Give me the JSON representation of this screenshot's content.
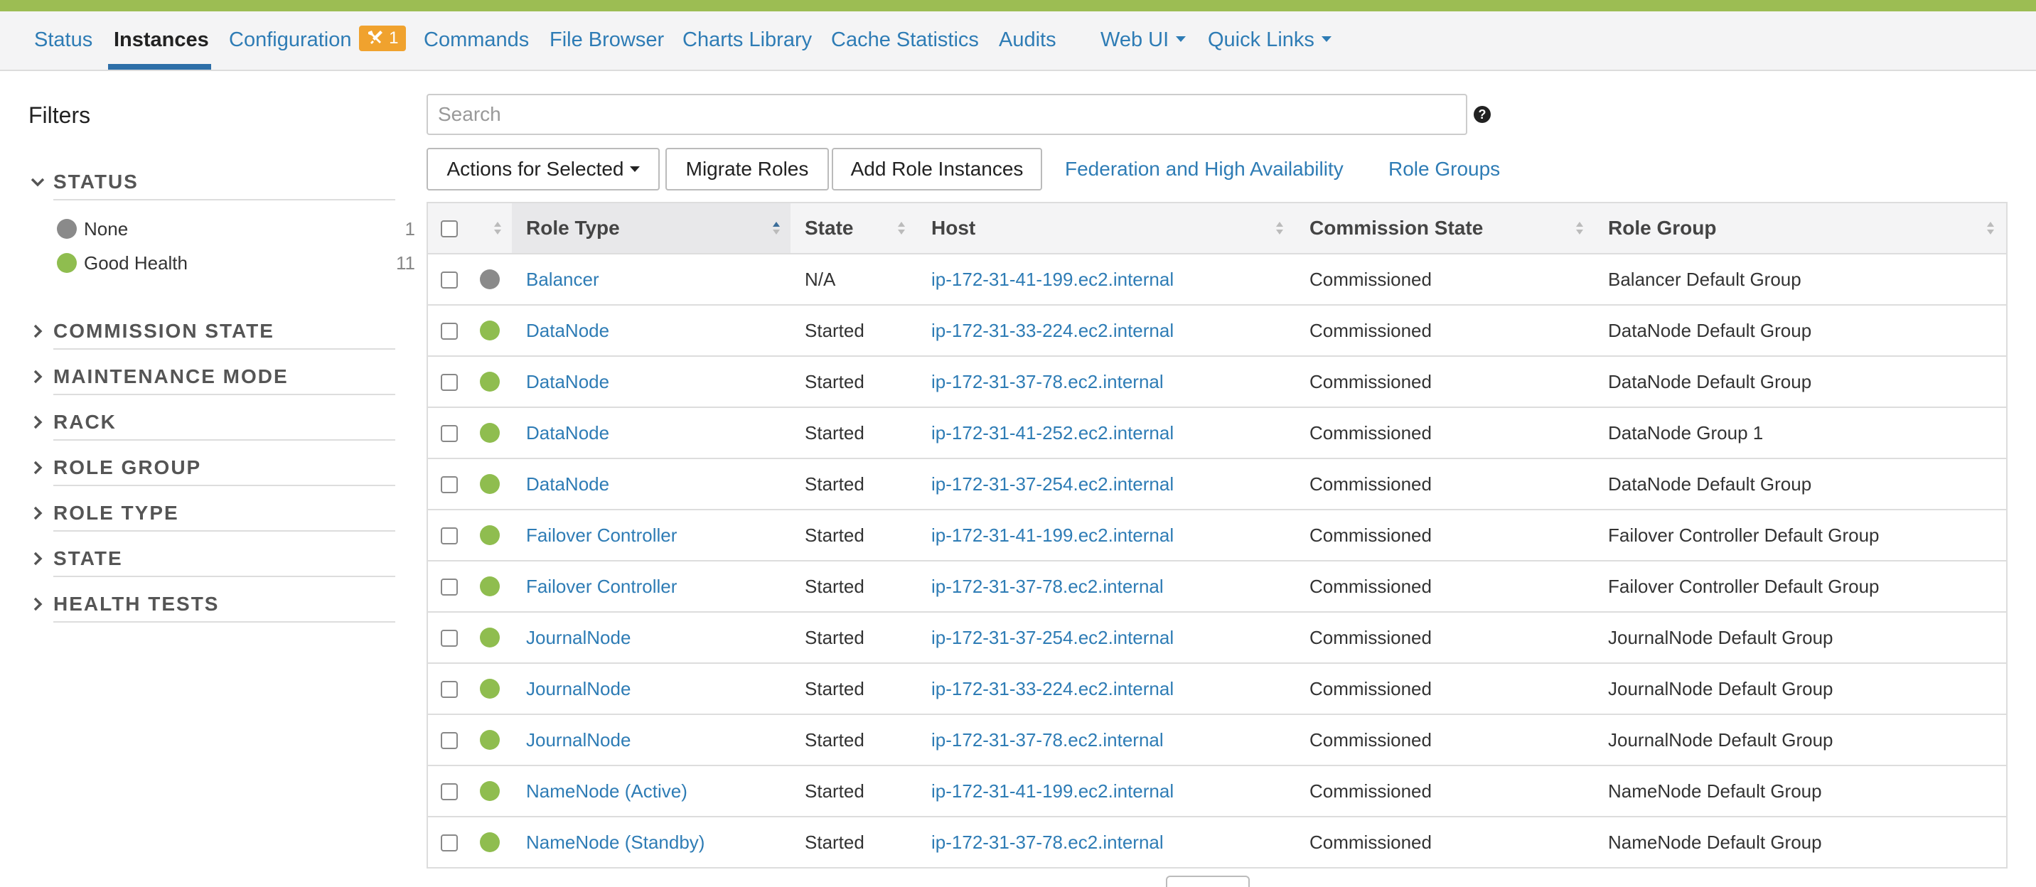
{
  "colors": {
    "accent": "#9cbd53",
    "link": "#2e7cb5",
    "health_good": "#8fbd4f",
    "health_none": "#8a8a8a",
    "badge": "#f0a22e"
  },
  "nav": {
    "tabs": [
      {
        "label": "Status"
      },
      {
        "label": "Instances",
        "active": true
      },
      {
        "label": "Configuration",
        "badge": "1"
      },
      {
        "label": "Commands"
      },
      {
        "label": "File Browser"
      },
      {
        "label": "Charts Library"
      },
      {
        "label": "Cache Statistics"
      },
      {
        "label": "Audits"
      },
      {
        "label": "Web UI",
        "dropdown": true
      },
      {
        "label": "Quick Links",
        "dropdown": true
      }
    ]
  },
  "sidebar": {
    "title": "Filters",
    "sections": [
      {
        "label": "STATUS",
        "expanded": true
      },
      {
        "label": "COMMISSION STATE"
      },
      {
        "label": "MAINTENANCE MODE"
      },
      {
        "label": "RACK"
      },
      {
        "label": "ROLE GROUP"
      },
      {
        "label": "ROLE TYPE"
      },
      {
        "label": "STATE"
      },
      {
        "label": "HEALTH TESTS"
      }
    ],
    "status_options": [
      {
        "label": "None",
        "count": "1",
        "icon": "health-none-icon"
      },
      {
        "label": "Good Health",
        "count": "11",
        "icon": "health-good-icon"
      }
    ]
  },
  "search": {
    "placeholder": "Search",
    "help": "?"
  },
  "actions": {
    "actions_for_selected": "Actions for Selected",
    "migrate_roles": "Migrate Roles",
    "add_role_instances": "Add Role Instances",
    "federation": "Federation and High Availability",
    "role_groups": "Role Groups"
  },
  "table": {
    "columns": [
      "Role Type",
      "State",
      "Host",
      "Commission State",
      "Role Group"
    ],
    "rows": [
      {
        "health": "none",
        "role_type": "Balancer",
        "state": "N/A",
        "host": "ip-172-31-41-199.ec2.internal",
        "commission": "Commissioned",
        "role_group": "Balancer Default Group"
      },
      {
        "health": "good",
        "role_type": "DataNode",
        "state": "Started",
        "host": "ip-172-31-33-224.ec2.internal",
        "commission": "Commissioned",
        "role_group": "DataNode Default Group"
      },
      {
        "health": "good",
        "role_type": "DataNode",
        "state": "Started",
        "host": "ip-172-31-37-78.ec2.internal",
        "commission": "Commissioned",
        "role_group": "DataNode Default Group"
      },
      {
        "health": "good",
        "role_type": "DataNode",
        "state": "Started",
        "host": "ip-172-31-41-252.ec2.internal",
        "commission": "Commissioned",
        "role_group": "DataNode Group 1"
      },
      {
        "health": "good",
        "role_type": "DataNode",
        "state": "Started",
        "host": "ip-172-31-37-254.ec2.internal",
        "commission": "Commissioned",
        "role_group": "DataNode Default Group"
      },
      {
        "health": "good",
        "role_type": "Failover Controller",
        "state": "Started",
        "host": "ip-172-31-41-199.ec2.internal",
        "commission": "Commissioned",
        "role_group": "Failover Controller Default Group"
      },
      {
        "health": "good",
        "role_type": "Failover Controller",
        "state": "Started",
        "host": "ip-172-31-37-78.ec2.internal",
        "commission": "Commissioned",
        "role_group": "Failover Controller Default Group"
      },
      {
        "health": "good",
        "role_type": "JournalNode",
        "state": "Started",
        "host": "ip-172-31-37-254.ec2.internal",
        "commission": "Commissioned",
        "role_group": "JournalNode Default Group"
      },
      {
        "health": "good",
        "role_type": "JournalNode",
        "state": "Started",
        "host": "ip-172-31-33-224.ec2.internal",
        "commission": "Commissioned",
        "role_group": "JournalNode Default Group"
      },
      {
        "health": "good",
        "role_type": "JournalNode",
        "state": "Started",
        "host": "ip-172-31-37-78.ec2.internal",
        "commission": "Commissioned",
        "role_group": "JournalNode Default Group"
      },
      {
        "health": "good",
        "role_type": "NameNode (Active)",
        "state": "Started",
        "host": "ip-172-31-41-199.ec2.internal",
        "commission": "Commissioned",
        "role_group": "NameNode Default Group"
      },
      {
        "health": "good",
        "role_type": "NameNode (Standby)",
        "state": "Started",
        "host": "ip-172-31-37-78.ec2.internal",
        "commission": "Commissioned",
        "role_group": "NameNode Default Group"
      }
    ]
  }
}
